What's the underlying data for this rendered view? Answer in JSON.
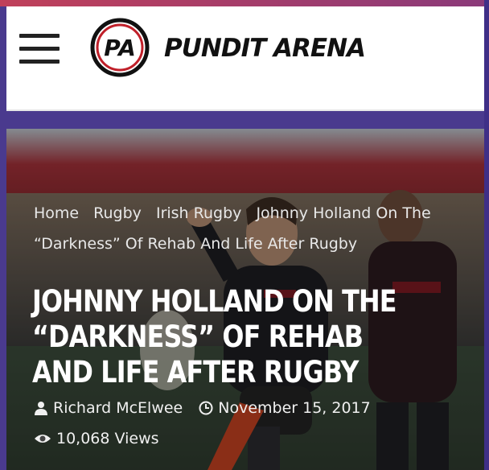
{
  "header": {
    "logo_badge_text": "PA",
    "logo_text": "PUNDIT ARENA",
    "menu_icon": "hamburger-menu-icon"
  },
  "breadcrumb": {
    "items": [
      "Home",
      "Rugby",
      "Irish Rugby"
    ],
    "current": "Johnny Holland On The “Darkness” Of Rehab And Life After Rugby"
  },
  "article": {
    "title": "Johnny Holland On The “Darkness” Of Rehab And Life After Rugby",
    "author": "Richard McElwee",
    "date": "November 15, 2017",
    "views": "10,068 Views"
  },
  "icons": {
    "author": "user-icon",
    "date": "clock-icon",
    "views": "eye-icon"
  }
}
